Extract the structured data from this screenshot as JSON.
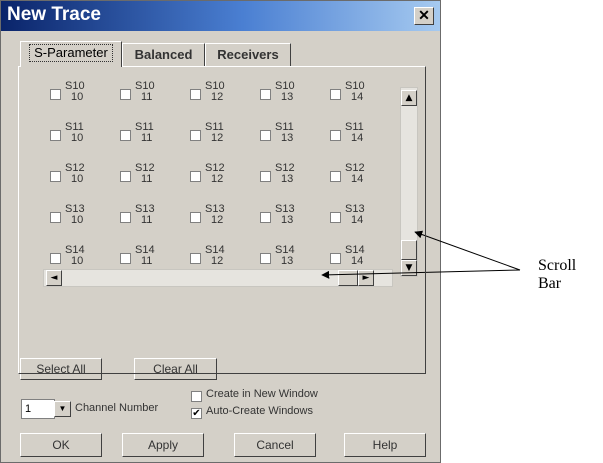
{
  "window": {
    "title": "New Trace",
    "close_glyph": "✕"
  },
  "tabs": [
    {
      "label": "S-Parameter",
      "active": true
    },
    {
      "label": "Balanced",
      "active": false
    },
    {
      "label": "Receivers",
      "active": false
    }
  ],
  "params": {
    "rows": [
      "S10",
      "S11",
      "S12",
      "S13",
      "S14"
    ],
    "cols": [
      "10",
      "11",
      "12",
      "13",
      "14"
    ],
    "checked": false
  },
  "scrollbars": {
    "up_glyph": "▲",
    "down_glyph": "▼",
    "left_glyph": "◄",
    "right_glyph": "►"
  },
  "buttons": {
    "select_all": "Select All",
    "clear_all": "Clear All",
    "ok": "OK",
    "apply": "Apply",
    "cancel": "Cancel",
    "help": "Help"
  },
  "channel": {
    "value": "1",
    "label": "Channel Number",
    "arrow": "▼"
  },
  "options": {
    "create_new_window": {
      "label": "Create in New Window",
      "checked": false
    },
    "auto_create_windows": {
      "label": "Auto-Create Windows",
      "checked": true,
      "mark": "✔"
    }
  },
  "annotation": {
    "label": "Scroll Bar"
  }
}
